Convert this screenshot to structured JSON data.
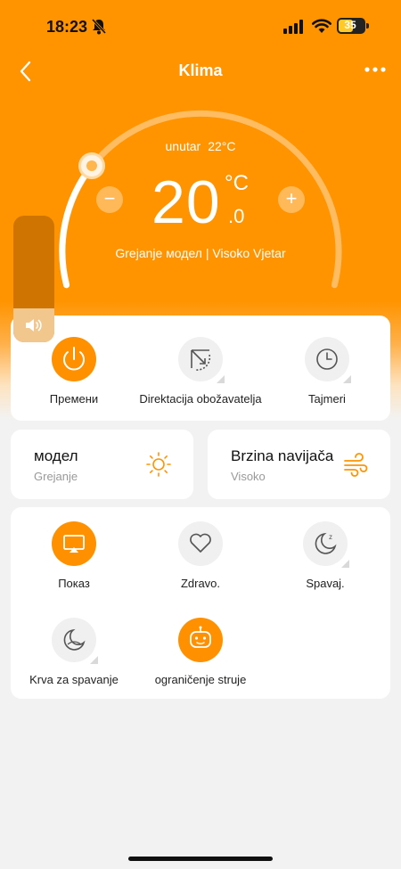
{
  "status": {
    "time": "18:23",
    "battery": "35"
  },
  "nav": {
    "title": "Klima"
  },
  "thermostat": {
    "inside_label": "unutar",
    "inside_temp": "22°C",
    "temp_whole": "20",
    "temp_unit": "°C",
    "temp_decimal": ".0",
    "minus": "−",
    "plus": "+",
    "mode_text": "Grejanje модел",
    "fan_text": "Visoko Vjetar"
  },
  "quick_actions": [
    {
      "label": "Премени",
      "icon": "power-icon",
      "active": true
    },
    {
      "label": "Direktacija obožavatelja",
      "icon": "fan-direction-icon",
      "active": false
    },
    {
      "label": "Tajmeri",
      "icon": "clock-icon",
      "active": false
    }
  ],
  "mode_card": {
    "title": "модел",
    "value": "Grejanje",
    "icon": "sun-icon"
  },
  "fan_card": {
    "title": "Brzina navijača",
    "value": "Visoko",
    "icon": "wind-icon"
  },
  "functions": [
    {
      "label": "Показ",
      "icon": "display-icon",
      "active": true
    },
    {
      "label": "Zdravo.",
      "icon": "heart-icon",
      "active": false
    },
    {
      "label": "Spavaj.",
      "icon": "sleep-moon-icon",
      "active": false
    },
    {
      "label": "Krva za spavanje",
      "icon": "moon-icon",
      "active": false
    },
    {
      "label": "ograničenje struje",
      "icon": "robot-icon",
      "active": true
    }
  ],
  "colors": {
    "accent": "#ff9400",
    "background": "#f2f2f2"
  }
}
